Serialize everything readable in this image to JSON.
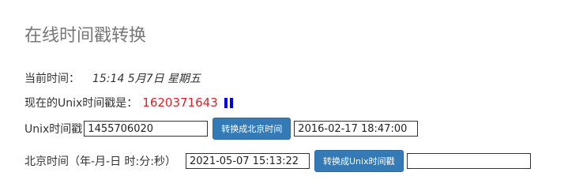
{
  "title": "在线时间戳转换",
  "current_time": {
    "label": "当前时间：",
    "value": "15:14 5月7日 星期五"
  },
  "unix_now": {
    "label": "现在的Unix时间戳是：",
    "value": "1620371643",
    "pause_icon": "pause-icon",
    "pause_color": "#0000ee"
  },
  "unix_convert": {
    "label": "Unix时间戳",
    "input_value": "1455706020",
    "button_label": "转换成北京时间",
    "result_value": "2016-02-17 18:47:00"
  },
  "beijing_convert": {
    "label": "北京时间（年-月-日 时:分:秒）",
    "input_value": "2021-05-07 15:13:22",
    "button_label": "转换成Unix时间戳",
    "result_value": ""
  },
  "colors": {
    "accent_button": "#337ab7",
    "unix_value": "#e31e25",
    "title": "#777777"
  }
}
